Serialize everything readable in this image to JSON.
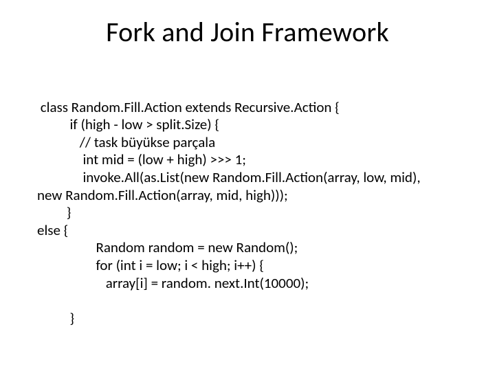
{
  "title": "Fork and Join Framework",
  "code": {
    "l1": " class Random.Fill.Action extends Recursive.Action {",
    "l2": "          if (high - low > split.Size) {",
    "l3": "             // task büyükse parçala",
    "l4": "              int mid = (low + high) >>> 1;",
    "l5": "              invoke.All(as.List(new Random.Fill.Action(array, low, mid),",
    "l6": "new Random.Fill.Action(array, mid, high)));",
    "l7": "         }",
    "l8": "else {",
    "l9": "                  Random random = new Random();",
    "l10": "                  for (int i = low; i < high; i++) {",
    "l11": "                     array[i] = random. next.Int(10000);",
    "l12": "",
    "l13": "          }"
  }
}
